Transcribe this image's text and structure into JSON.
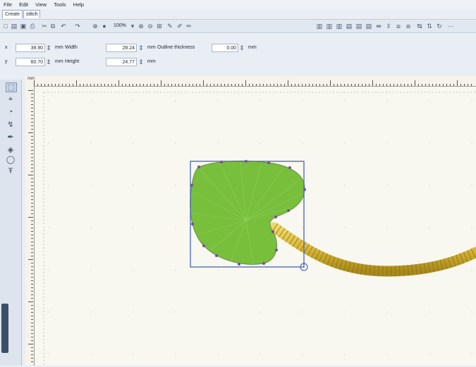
{
  "menu": [
    "File",
    "Edit",
    "View",
    "Tools",
    "Help"
  ],
  "tabs": [
    {
      "label": "Create",
      "active": true
    },
    {
      "label": "stitch",
      "active": false
    }
  ],
  "toolbar": {
    "zoom": "100%"
  },
  "properties": {
    "x_value": "39.90",
    "y_value": "60.70",
    "width_label": "Width",
    "height_label": "Height",
    "width_value": "28.24",
    "height_value": "24.77",
    "unit": "mm",
    "outline_label": "Outline thickness",
    "outline_value": "0.00",
    "x_label": "x",
    "y_label": "y"
  },
  "ruler": {
    "unit": "mm"
  },
  "colors": {
    "leaf_fill": "#78bf3c",
    "selection": "#4f6fb5",
    "rope": "#d8b738"
  }
}
